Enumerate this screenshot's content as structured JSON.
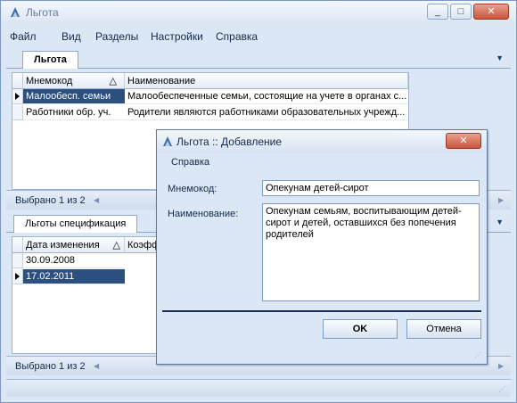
{
  "app": {
    "title": "Льгота",
    "controls": {
      "minimize": "_",
      "maximize": "□",
      "close": "✕"
    }
  },
  "menu": [
    "Файл",
    "Вид",
    "Разделы",
    "Настройки",
    "Справка"
  ],
  "tab_top": {
    "label": "Льгота",
    "arrow": "▼"
  },
  "grid_top": {
    "headers": [
      "Мнемокод",
      "Наименование"
    ],
    "sort_mark": "△",
    "rows": [
      {
        "mnemo": "Малообесп. семьи",
        "name": "Малообеспеченные семьи, состоящие на учете в органах с..."
      },
      {
        "mnemo": "Работники обр. уч.",
        "name": "Родители являются работниками образовательных учрежд..."
      }
    ],
    "status": "Выбрано 1 из 2",
    "status_arrow_left": "◀",
    "status_arrow_right": "▶"
  },
  "tab_bottom": {
    "label": "Льготы спецификация",
    "arrow": "▼"
  },
  "grid_bottom": {
    "headers": [
      "Дата изменения",
      "Коэфф"
    ],
    "sort_mark": "△",
    "rows": [
      {
        "date": "30.09.2008"
      },
      {
        "date": "17.02.2011"
      }
    ],
    "status": "Выбрано 1 из 2",
    "status_arrow_left": "◀",
    "status_arrow_right": "▶"
  },
  "dialog": {
    "title": "Льгота :: Добавление",
    "menu": "Справка",
    "close": "✕",
    "fields": {
      "mnemo_label": "Мнемокод:",
      "mnemo_value": "Опекунам детей-сирот",
      "name_label": "Наименование:",
      "name_value": "Опекунам семьям, воспитывающим детей-сирот и детей, оставшихся без попечения родителей"
    },
    "ok_label": "OK",
    "cancel_label": "Отмена",
    "grip": "⋰"
  },
  "colors": {
    "selection": "#2b4f7f",
    "accent": "#dce7f5",
    "close": "#c9553d"
  }
}
